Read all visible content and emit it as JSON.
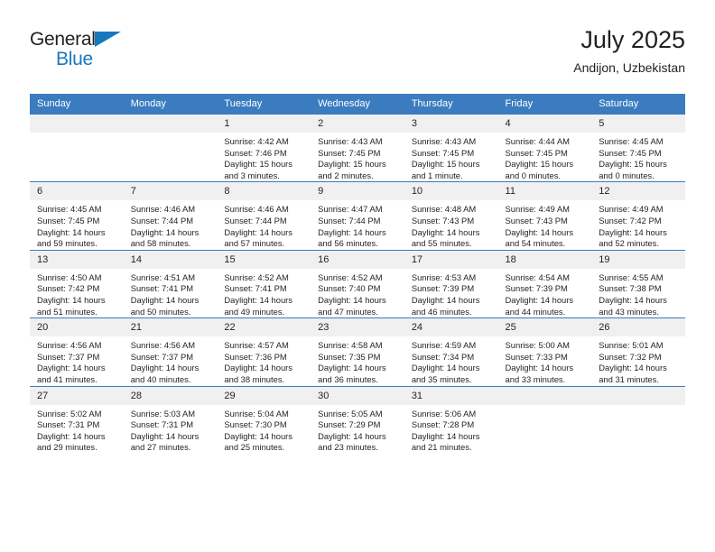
{
  "brand": {
    "name_part1": "General",
    "name_part2": "Blue",
    "accent_color": "#1878be"
  },
  "header": {
    "title": "July 2025",
    "subtitle": "Andijon, Uzbekistan",
    "header_bg": "#3a7cbf"
  },
  "weekdays": [
    "Sunday",
    "Monday",
    "Tuesday",
    "Wednesday",
    "Thursday",
    "Friday",
    "Saturday"
  ],
  "labels": {
    "sunrise": "Sunrise:",
    "sunset": "Sunset:",
    "daylight": "Daylight:"
  },
  "weeks": [
    [
      {
        "day": "",
        "empty": true
      },
      {
        "day": "",
        "empty": true
      },
      {
        "day": "1",
        "sunrise": "Sunrise: 4:42 AM",
        "sunset": "Sunset: 7:46 PM",
        "daylight_1": "Daylight: 15 hours",
        "daylight_2": "and 3 minutes."
      },
      {
        "day": "2",
        "sunrise": "Sunrise: 4:43 AM",
        "sunset": "Sunset: 7:45 PM",
        "daylight_1": "Daylight: 15 hours",
        "daylight_2": "and 2 minutes."
      },
      {
        "day": "3",
        "sunrise": "Sunrise: 4:43 AM",
        "sunset": "Sunset: 7:45 PM",
        "daylight_1": "Daylight: 15 hours",
        "daylight_2": "and 1 minute."
      },
      {
        "day": "4",
        "sunrise": "Sunrise: 4:44 AM",
        "sunset": "Sunset: 7:45 PM",
        "daylight_1": "Daylight: 15 hours",
        "daylight_2": "and 0 minutes."
      },
      {
        "day": "5",
        "sunrise": "Sunrise: 4:45 AM",
        "sunset": "Sunset: 7:45 PM",
        "daylight_1": "Daylight: 15 hours",
        "daylight_2": "and 0 minutes."
      }
    ],
    [
      {
        "day": "6",
        "sunrise": "Sunrise: 4:45 AM",
        "sunset": "Sunset: 7:45 PM",
        "daylight_1": "Daylight: 14 hours",
        "daylight_2": "and 59 minutes."
      },
      {
        "day": "7",
        "sunrise": "Sunrise: 4:46 AM",
        "sunset": "Sunset: 7:44 PM",
        "daylight_1": "Daylight: 14 hours",
        "daylight_2": "and 58 minutes."
      },
      {
        "day": "8",
        "sunrise": "Sunrise: 4:46 AM",
        "sunset": "Sunset: 7:44 PM",
        "daylight_1": "Daylight: 14 hours",
        "daylight_2": "and 57 minutes."
      },
      {
        "day": "9",
        "sunrise": "Sunrise: 4:47 AM",
        "sunset": "Sunset: 7:44 PM",
        "daylight_1": "Daylight: 14 hours",
        "daylight_2": "and 56 minutes."
      },
      {
        "day": "10",
        "sunrise": "Sunrise: 4:48 AM",
        "sunset": "Sunset: 7:43 PM",
        "daylight_1": "Daylight: 14 hours",
        "daylight_2": "and 55 minutes."
      },
      {
        "day": "11",
        "sunrise": "Sunrise: 4:49 AM",
        "sunset": "Sunset: 7:43 PM",
        "daylight_1": "Daylight: 14 hours",
        "daylight_2": "and 54 minutes."
      },
      {
        "day": "12",
        "sunrise": "Sunrise: 4:49 AM",
        "sunset": "Sunset: 7:42 PM",
        "daylight_1": "Daylight: 14 hours",
        "daylight_2": "and 52 minutes."
      }
    ],
    [
      {
        "day": "13",
        "sunrise": "Sunrise: 4:50 AM",
        "sunset": "Sunset: 7:42 PM",
        "daylight_1": "Daylight: 14 hours",
        "daylight_2": "and 51 minutes."
      },
      {
        "day": "14",
        "sunrise": "Sunrise: 4:51 AM",
        "sunset": "Sunset: 7:41 PM",
        "daylight_1": "Daylight: 14 hours",
        "daylight_2": "and 50 minutes."
      },
      {
        "day": "15",
        "sunrise": "Sunrise: 4:52 AM",
        "sunset": "Sunset: 7:41 PM",
        "daylight_1": "Daylight: 14 hours",
        "daylight_2": "and 49 minutes."
      },
      {
        "day": "16",
        "sunrise": "Sunrise: 4:52 AM",
        "sunset": "Sunset: 7:40 PM",
        "daylight_1": "Daylight: 14 hours",
        "daylight_2": "and 47 minutes."
      },
      {
        "day": "17",
        "sunrise": "Sunrise: 4:53 AM",
        "sunset": "Sunset: 7:39 PM",
        "daylight_1": "Daylight: 14 hours",
        "daylight_2": "and 46 minutes."
      },
      {
        "day": "18",
        "sunrise": "Sunrise: 4:54 AM",
        "sunset": "Sunset: 7:39 PM",
        "daylight_1": "Daylight: 14 hours",
        "daylight_2": "and 44 minutes."
      },
      {
        "day": "19",
        "sunrise": "Sunrise: 4:55 AM",
        "sunset": "Sunset: 7:38 PM",
        "daylight_1": "Daylight: 14 hours",
        "daylight_2": "and 43 minutes."
      }
    ],
    [
      {
        "day": "20",
        "sunrise": "Sunrise: 4:56 AM",
        "sunset": "Sunset: 7:37 PM",
        "daylight_1": "Daylight: 14 hours",
        "daylight_2": "and 41 minutes."
      },
      {
        "day": "21",
        "sunrise": "Sunrise: 4:56 AM",
        "sunset": "Sunset: 7:37 PM",
        "daylight_1": "Daylight: 14 hours",
        "daylight_2": "and 40 minutes."
      },
      {
        "day": "22",
        "sunrise": "Sunrise: 4:57 AM",
        "sunset": "Sunset: 7:36 PM",
        "daylight_1": "Daylight: 14 hours",
        "daylight_2": "and 38 minutes."
      },
      {
        "day": "23",
        "sunrise": "Sunrise: 4:58 AM",
        "sunset": "Sunset: 7:35 PM",
        "daylight_1": "Daylight: 14 hours",
        "daylight_2": "and 36 minutes."
      },
      {
        "day": "24",
        "sunrise": "Sunrise: 4:59 AM",
        "sunset": "Sunset: 7:34 PM",
        "daylight_1": "Daylight: 14 hours",
        "daylight_2": "and 35 minutes."
      },
      {
        "day": "25",
        "sunrise": "Sunrise: 5:00 AM",
        "sunset": "Sunset: 7:33 PM",
        "daylight_1": "Daylight: 14 hours",
        "daylight_2": "and 33 minutes."
      },
      {
        "day": "26",
        "sunrise": "Sunrise: 5:01 AM",
        "sunset": "Sunset: 7:32 PM",
        "daylight_1": "Daylight: 14 hours",
        "daylight_2": "and 31 minutes."
      }
    ],
    [
      {
        "day": "27",
        "sunrise": "Sunrise: 5:02 AM",
        "sunset": "Sunset: 7:31 PM",
        "daylight_1": "Daylight: 14 hours",
        "daylight_2": "and 29 minutes."
      },
      {
        "day": "28",
        "sunrise": "Sunrise: 5:03 AM",
        "sunset": "Sunset: 7:31 PM",
        "daylight_1": "Daylight: 14 hours",
        "daylight_2": "and 27 minutes."
      },
      {
        "day": "29",
        "sunrise": "Sunrise: 5:04 AM",
        "sunset": "Sunset: 7:30 PM",
        "daylight_1": "Daylight: 14 hours",
        "daylight_2": "and 25 minutes."
      },
      {
        "day": "30",
        "sunrise": "Sunrise: 5:05 AM",
        "sunset": "Sunset: 7:29 PM",
        "daylight_1": "Daylight: 14 hours",
        "daylight_2": "and 23 minutes."
      },
      {
        "day": "31",
        "sunrise": "Sunrise: 5:06 AM",
        "sunset": "Sunset: 7:28 PM",
        "daylight_1": "Daylight: 14 hours",
        "daylight_2": "and 21 minutes."
      },
      {
        "day": "",
        "empty": true
      },
      {
        "day": "",
        "empty": true
      }
    ]
  ]
}
